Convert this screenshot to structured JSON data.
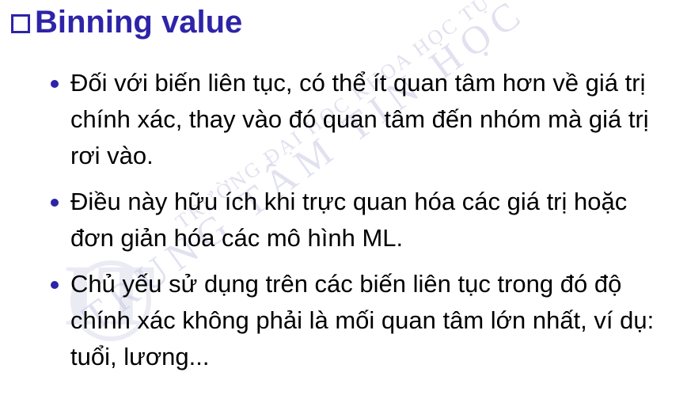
{
  "title": "Binning value",
  "watermark": "TRƯỜNG ĐẠI HỌC KHOA HỌC TỰ NHIÊN TRUNG TÂM TIN HỌC",
  "colors": {
    "accent": "#2e24a8",
    "watermark": "#cfcfe6"
  },
  "bullets": [
    {
      "text": "Đối với biến liên tục, có thể ít quan tâm hơn về giá trị chính xác, thay vào đó quan tâm đến nhóm mà giá trị rơi vào."
    },
    {
      "text": "Điều này hữu ích khi trực quan hóa các giá trị hoặc đơn giản hóa các mô hình ML."
    },
    {
      "text": "Chủ yếu sử dụng trên các biến liên tục trong đó độ chính xác không phải là mối quan tâm lớn nhất, ví dụ: tuổi, lương..."
    }
  ]
}
